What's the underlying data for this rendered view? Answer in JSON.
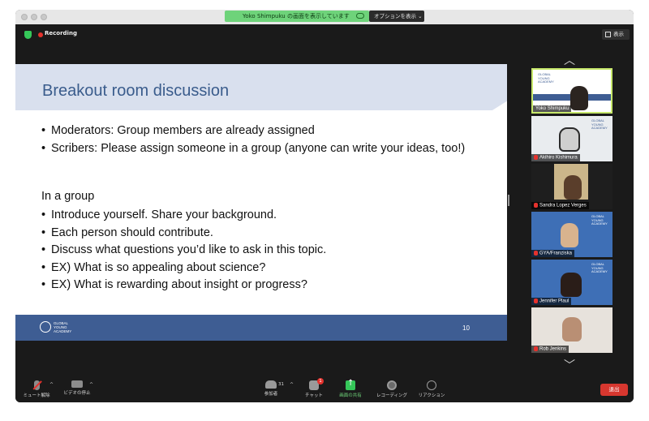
{
  "titlebar": {
    "share_status": "Yoko Shimpuku の画面を表示しています",
    "options_label": "オプションを表示"
  },
  "meeting": {
    "recording_label": "Recording",
    "view_label": "表示"
  },
  "slide": {
    "title": "Breakout room discussion",
    "bullets_top": [
      "Moderators: Group members are already assigned",
      "Scribers: Please assign someone in a group (anyone can write your ideas, too!)"
    ],
    "group_heading": "In a group",
    "bullets_group": [
      "Introduce yourself. Share your background.",
      "Each person should contribute.",
      "Discuss what questions you’d like to ask in this topic.",
      "EX) What is so appealing about science?",
      "EX) What is rewarding about insight or progress?"
    ],
    "footer_logo_text": "GLOBAL YOUNG ACADEMY",
    "page_number": "10"
  },
  "participants": [
    {
      "name": "Yoko Shimpuku",
      "muted": false,
      "active": true
    },
    {
      "name": "Akihiro Kishimura",
      "muted": true,
      "active": false
    },
    {
      "name": "Sandra Lopez Verges",
      "muted": true,
      "active": false
    },
    {
      "name": "GYA/Franziska",
      "muted": true,
      "active": false
    },
    {
      "name": "Jennifer Plaul",
      "muted": true,
      "active": false
    },
    {
      "name": "Rob Jenkins",
      "muted": true,
      "active": false
    }
  ],
  "controls": {
    "unmute": "ミュート解除",
    "stop_video": "ビデオの停止",
    "participants": "参加者",
    "participant_count": "31",
    "chat": "チャット",
    "chat_badge": "1",
    "share_screen": "画面の共有",
    "recording": "レコーディング",
    "reactions": "リアクション",
    "leave": "退出"
  },
  "colors": {
    "slide_accent": "#3e5d93",
    "share_green": "#6ed37a",
    "leave_red": "#d7372f",
    "active_border": "#c7e86b"
  }
}
